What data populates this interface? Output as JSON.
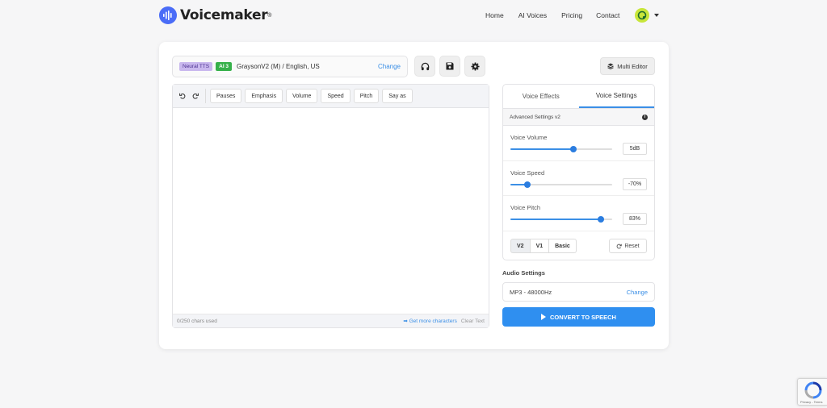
{
  "brand": {
    "name": "Voicemaker",
    "reg": "®"
  },
  "nav": {
    "home": "Home",
    "ai_voices": "AI Voices",
    "pricing": "Pricing",
    "contact": "Contact"
  },
  "voice": {
    "badge_neural": "Neural TTS",
    "badge_ai": "AI 3",
    "name": "GraysonV2 (M) / English, US",
    "change": "Change"
  },
  "multi_editor": "Multi Editor",
  "toolbar": {
    "pauses": "Pauses",
    "emphasis": "Emphasis",
    "volume": "Volume",
    "speed": "Speed",
    "pitch": "Pitch",
    "say_as": "Say as"
  },
  "editor": {
    "text": "",
    "chars_used": "0/250 chars used",
    "more_chars": "➡ Get more characters",
    "clear": "Clear Text"
  },
  "tabs": {
    "effects": "Voice Effects",
    "settings": "Voice Settings"
  },
  "advanced": "Advanced Settings v2",
  "sliders": {
    "volume": {
      "label": "Voice Volume",
      "value": "5dB",
      "fraction": 0.62
    },
    "speed": {
      "label": "Voice Speed",
      "value": "-70%",
      "fraction": 0.17
    },
    "pitch": {
      "label": "Voice Pitch",
      "value": "83%",
      "fraction": 0.89
    }
  },
  "versions": {
    "v2": "V2",
    "v1": "V1",
    "basic": "Basic",
    "reset": "Reset"
  },
  "audio": {
    "title": "Audio Settings",
    "format": "MP3 - 48000Hz",
    "change": "Change"
  },
  "convert": "CONVERT TO SPEECH",
  "recaptcha": "Privacy - Terms",
  "colors": {
    "accent": "#3b8fe6",
    "convert": "#2f8ff0",
    "ai_badge": "#36b04a",
    "neural_badge": "#c9b8ee",
    "avatar": "#c8e63a"
  }
}
